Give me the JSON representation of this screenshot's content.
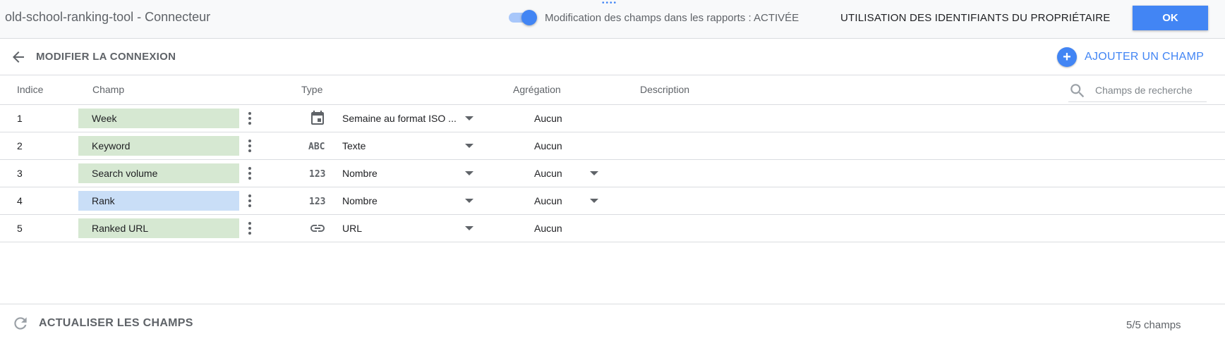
{
  "topbar": {
    "title": "old-school-ranking-tool - Connecteur",
    "toggle_label": "Modification des champs dans les rapports : ACTIVÉE",
    "toggle_on": true,
    "credentials_label": "UTILISATION DES IDENTIFIANTS DU PROPRIÉTAIRE",
    "ok_label": "OK"
  },
  "header": {
    "back_label": "MODIFIER LA CONNEXION",
    "add_field_label": "AJOUTER UN CHAMP"
  },
  "table": {
    "columns": {
      "index": "Indice",
      "field": "Champ",
      "type": "Type",
      "aggregation": "Agrégation",
      "description": "Description"
    },
    "search_placeholder": "Champs de recherche",
    "rows": [
      {
        "index": "1",
        "field": "Week",
        "field_kind": "dimension",
        "type_icon": "calendar-icon",
        "type": "Semaine au format ISO ...",
        "aggregation": "Aucun",
        "aggregation_dropdown": false
      },
      {
        "index": "2",
        "field": "Keyword",
        "field_kind": "dimension",
        "type_icon": "abc-text-icon",
        "type": "Texte",
        "aggregation": "Aucun",
        "aggregation_dropdown": false
      },
      {
        "index": "3",
        "field": "Search volume",
        "field_kind": "dimension",
        "type_icon": "number-123-icon",
        "type": "Nombre",
        "aggregation": "Aucun",
        "aggregation_dropdown": true
      },
      {
        "index": "4",
        "field": "Rank",
        "field_kind": "metric",
        "type_icon": "number-123-icon",
        "type": "Nombre",
        "aggregation": "Aucun",
        "aggregation_dropdown": true
      },
      {
        "index": "5",
        "field": "Ranked URL",
        "field_kind": "dimension",
        "type_icon": "link-icon",
        "type": "URL",
        "aggregation": "Aucun",
        "aggregation_dropdown": false
      }
    ]
  },
  "footer": {
    "refresh_label": "ACTUALISER LES CHAMPS",
    "field_count": "5/5 champs"
  },
  "colors": {
    "accent": "#4285f4",
    "dimension_chip": "#d6e8d2",
    "metric_chip": "#c9def7"
  }
}
